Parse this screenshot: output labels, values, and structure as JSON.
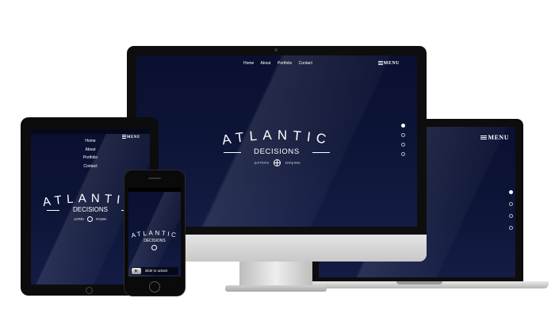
{
  "brand": {
    "title": "ATLANTIC",
    "subtitle": "DECISIONS",
    "tagline_left": "portfolio",
    "tagline_right": "template"
  },
  "nav": {
    "items": [
      "Home",
      "About",
      "Portfolio",
      "Contact"
    ],
    "menu_label": "MENU"
  },
  "phone": {
    "unlock_label": "slide to unlock"
  },
  "section_dots": {
    "count": 4,
    "active_index": 0
  },
  "colors": {
    "screen_navy": "#0a1030",
    "device_black": "#111111",
    "stand_silver": "#d9d9d9"
  }
}
